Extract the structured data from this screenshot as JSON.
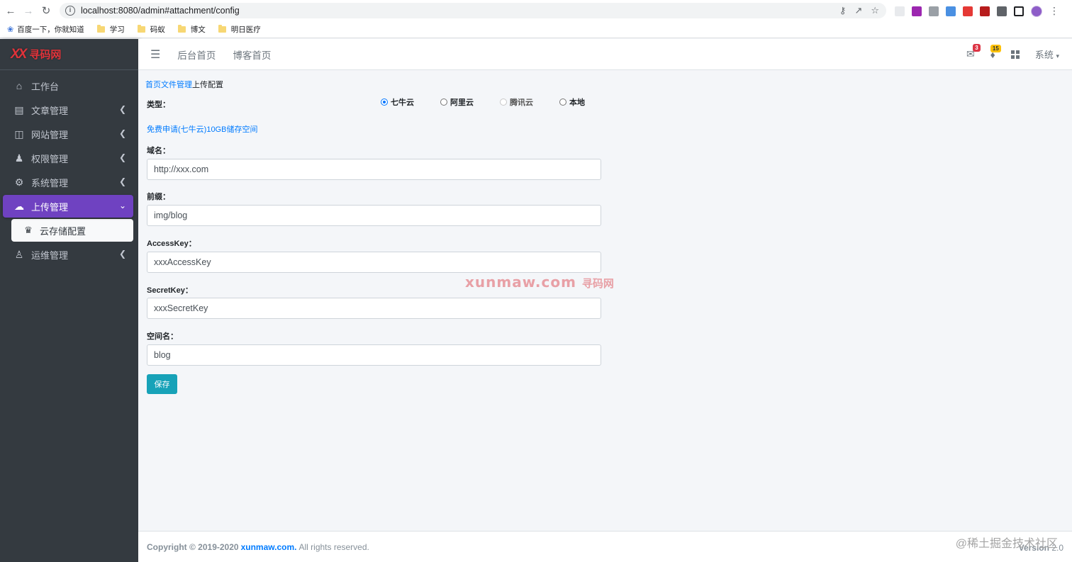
{
  "browser": {
    "back_icon": "arrow-left",
    "forward_icon": "arrow-right",
    "reload_icon": "reload",
    "url": "localhost:8080/admin#attachment/config",
    "bookmarks": [
      {
        "label": "百度一下，你就知道",
        "icon": "baidu-paw"
      },
      {
        "label": "学习",
        "icon": "folder"
      },
      {
        "label": "码蚁",
        "icon": "folder"
      },
      {
        "label": "博文",
        "icon": "folder"
      },
      {
        "label": "明日医疗",
        "icon": "folder"
      }
    ]
  },
  "sidebar": {
    "brand_logo": "XX",
    "brand_name": "寻码网",
    "items": [
      {
        "label": "工作台",
        "icon": "home-icon"
      },
      {
        "label": "文章管理",
        "icon": "table-icon"
      },
      {
        "label": "网站管理",
        "icon": "columns-icon"
      },
      {
        "label": "权限管理",
        "icon": "user-lock-icon"
      },
      {
        "label": "系统管理",
        "icon": "gear-icon"
      },
      {
        "label": "上传管理",
        "icon": "cloud-upload-icon",
        "active": true
      },
      {
        "label": "运维管理",
        "icon": "users-icon"
      }
    ],
    "submenu": {
      "label": "云存储配置",
      "icon": "crown-icon"
    }
  },
  "navbar": {
    "links": [
      "后台首页",
      "博客首页"
    ],
    "messages_badge": "3",
    "notifications_badge": "15",
    "system_label": "系统"
  },
  "content": {
    "breadcrumb": {
      "home": "首页",
      "section": "文件管理",
      "current": "上传配置"
    },
    "type_label": "类型：",
    "types": [
      {
        "label": "七牛云",
        "checked": true,
        "disabled": false
      },
      {
        "label": "阿里云",
        "checked": false,
        "disabled": false
      },
      {
        "label": "腾讯云",
        "checked": false,
        "disabled": true
      },
      {
        "label": "本地",
        "checked": false,
        "disabled": false
      }
    ],
    "apply_link": "免费申请(七牛云)10GB储存空间",
    "fields": [
      {
        "label": "域名：",
        "value": "http://xxx.com"
      },
      {
        "label": "前缀：",
        "value": "img/blog"
      },
      {
        "label": "AccessKey：",
        "value": "xxxAccessKey"
      },
      {
        "label": "SecretKey：",
        "value": "xxxSecretKey"
      },
      {
        "label": "空间名：",
        "value": "blog"
      }
    ],
    "save_label": "保存",
    "watermark": "xunmaw.com",
    "watermark_cn": "寻码网"
  },
  "footer": {
    "copyright": "Copyright © 2019-2020",
    "brand": "xunmaw.com.",
    "rights": "All rights reserved.",
    "version_label": "Version",
    "version": "2.0",
    "juejin": "@稀土掘金技术社区"
  },
  "colors": {
    "sidebar_bg": "#343a40",
    "active_menu": "#6f42c1",
    "save_button": "#17a2b8",
    "link": "#007bff"
  }
}
